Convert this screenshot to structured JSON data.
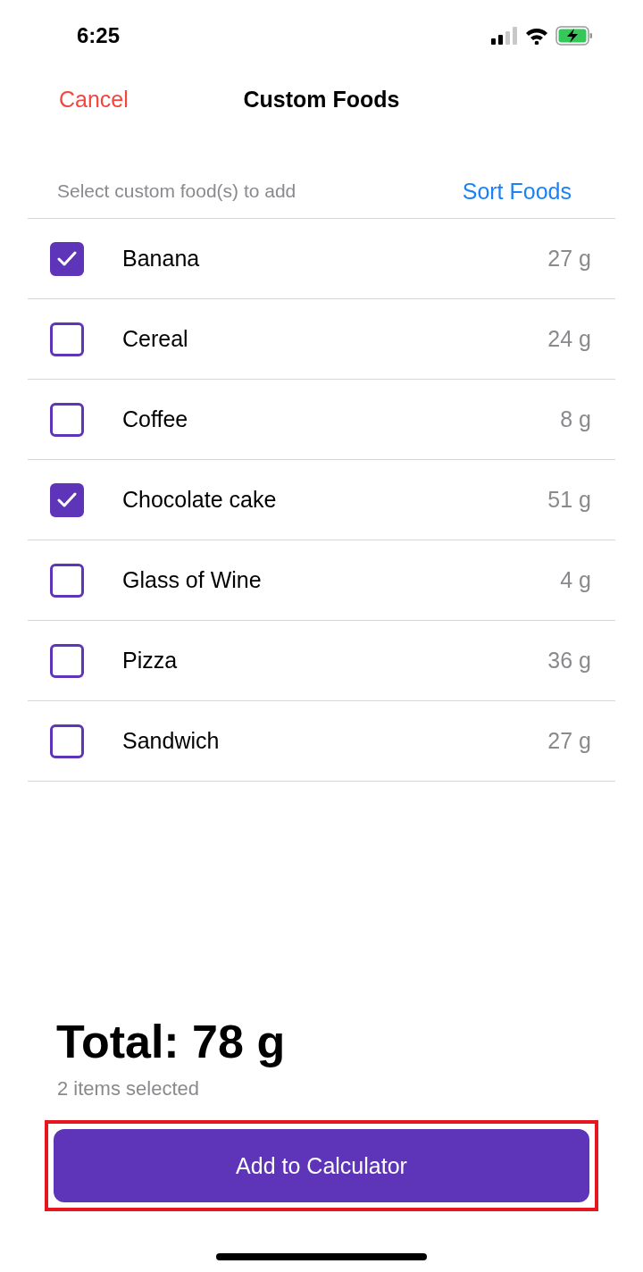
{
  "status_bar": {
    "time": "6:25",
    "charging": true
  },
  "nav": {
    "cancel": "Cancel",
    "title": "Custom Foods"
  },
  "subheader": {
    "hint": "Select custom food(s) to add",
    "sort": "Sort Foods"
  },
  "foods": [
    {
      "name": "Banana",
      "amount": "27 g",
      "checked": true
    },
    {
      "name": "Cereal",
      "amount": "24 g",
      "checked": false
    },
    {
      "name": "Coffee",
      "amount": "8 g",
      "checked": false
    },
    {
      "name": "Chocolate cake",
      "amount": "51 g",
      "checked": true
    },
    {
      "name": "Glass of Wine",
      "amount": "4 g",
      "checked": false
    },
    {
      "name": "Pizza",
      "amount": "36 g",
      "checked": false
    },
    {
      "name": "Sandwich",
      "amount": "27 g",
      "checked": false
    }
  ],
  "summary": {
    "total": "Total: 78 g",
    "count": "2 items selected"
  },
  "action": {
    "label": "Add to Calculator",
    "highlighted": true
  }
}
